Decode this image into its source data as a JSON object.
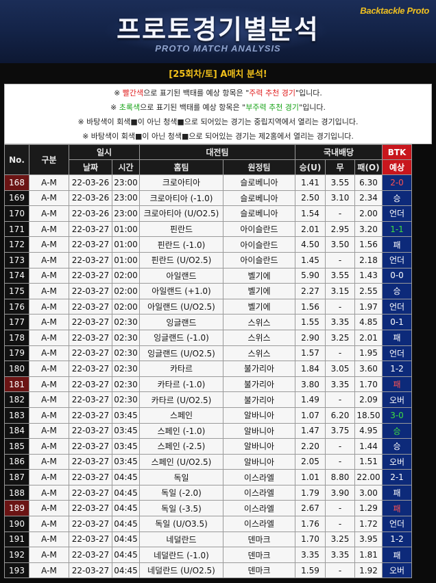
{
  "banner": {
    "title": "프로토경기별분석",
    "subtitle": "PROTO MATCH ANALYSIS",
    "brand": "Backtackle Proto"
  },
  "round_label": "[25회차/토] A매치 분석!",
  "notes": [
    {
      "pre": "※ ",
      "colored": "빨간색",
      "mid": "으로 표기된 백태를 예상 항목은 \"",
      "quote": "주력 추천 경기",
      "post": "\"입니다.",
      "color": "red"
    },
    {
      "pre": "※ ",
      "colored": "초록색",
      "mid": "으로 표기된 백태를 예상 항목은 \"",
      "quote": "부주력 추천 경기",
      "post": "\"입니다.",
      "color": "green"
    }
  ],
  "notes_plain": [
    "※ 바탕색이 회색■이 아닌 청색■으로 되어있는 경기는 중립지역에서 열리는 경기입니다.",
    "※ 바탕색이 회색■이 아닌 청색■으로 되어있는 경기는 제2홈에서 열리는 경기입니다."
  ],
  "header": {
    "no": "No.",
    "type": "구분",
    "datetime": "일시",
    "date": "날짜",
    "time": "시간",
    "match": "대전팀",
    "home": "홈팀",
    "away": "원정팀",
    "odds": "국내배당",
    "win": "승(U)",
    "draw": "무",
    "lose": "패(O)",
    "btk1": "BTK",
    "btk2": "예상"
  },
  "rows": [
    {
      "no": "168",
      "type": "A-M",
      "date": "22-03-26",
      "time": "23:00",
      "home": "크로아티아",
      "away": "슬로베니아",
      "w": "1.41",
      "d": "3.55",
      "l": "6.30",
      "pred": "2-0",
      "pc": "red"
    },
    {
      "no": "169",
      "type": "A-M",
      "date": "22-03-26",
      "time": "23:00",
      "home": "크로아티아 (-1.0)",
      "away": "슬로베니아",
      "w": "2.50",
      "d": "3.10",
      "l": "2.34",
      "pred": "승",
      "pc": ""
    },
    {
      "no": "170",
      "type": "A-M",
      "date": "22-03-26",
      "time": "23:00",
      "home": "크로아티아 (U/O2.5)",
      "away": "슬로베니아",
      "w": "1.54",
      "d": "-",
      "l": "2.00",
      "pred": "언더",
      "pc": ""
    },
    {
      "no": "171",
      "type": "A-M",
      "date": "22-03-27",
      "time": "01:00",
      "home": "핀란드",
      "away": "아이슬란드",
      "w": "2.01",
      "d": "2.95",
      "l": "3.20",
      "pred": "1-1",
      "pc": "green"
    },
    {
      "no": "172",
      "type": "A-M",
      "date": "22-03-27",
      "time": "01:00",
      "home": "핀란드 (-1.0)",
      "away": "아이슬란드",
      "w": "4.50",
      "d": "3.50",
      "l": "1.56",
      "pred": "패",
      "pc": ""
    },
    {
      "no": "173",
      "type": "A-M",
      "date": "22-03-27",
      "time": "01:00",
      "home": "핀란드 (U/O2.5)",
      "away": "아이슬란드",
      "w": "1.45",
      "d": "-",
      "l": "2.18",
      "pred": "언더",
      "pc": ""
    },
    {
      "no": "174",
      "type": "A-M",
      "date": "22-03-27",
      "time": "02:00",
      "home": "아일랜드",
      "away": "벨기에",
      "w": "5.90",
      "d": "3.55",
      "l": "1.43",
      "pred": "0-0",
      "pc": ""
    },
    {
      "no": "175",
      "type": "A-M",
      "date": "22-03-27",
      "time": "02:00",
      "home": "아일랜드 (+1.0)",
      "away": "벨기에",
      "w": "2.27",
      "d": "3.15",
      "l": "2.55",
      "pred": "승",
      "pc": ""
    },
    {
      "no": "176",
      "type": "A-M",
      "date": "22-03-27",
      "time": "02:00",
      "home": "아일랜드 (U/O2.5)",
      "away": "벨기에",
      "w": "1.56",
      "d": "-",
      "l": "1.97",
      "pred": "언더",
      "pc": ""
    },
    {
      "no": "177",
      "type": "A-M",
      "date": "22-03-27",
      "time": "02:30",
      "home": "잉글랜드",
      "away": "스위스",
      "w": "1.55",
      "d": "3.35",
      "l": "4.85",
      "pred": "0-1",
      "pc": ""
    },
    {
      "no": "178",
      "type": "A-M",
      "date": "22-03-27",
      "time": "02:30",
      "home": "잉글랜드 (-1.0)",
      "away": "스위스",
      "w": "2.90",
      "d": "3.25",
      "l": "2.01",
      "pred": "패",
      "pc": ""
    },
    {
      "no": "179",
      "type": "A-M",
      "date": "22-03-27",
      "time": "02:30",
      "home": "잉글랜드 (U/O2.5)",
      "away": "스위스",
      "w": "1.57",
      "d": "-",
      "l": "1.95",
      "pred": "언더",
      "pc": ""
    },
    {
      "no": "180",
      "type": "A-M",
      "date": "22-03-27",
      "time": "02:30",
      "home": "카타르",
      "away": "불가리아",
      "w": "1.84",
      "d": "3.05",
      "l": "3.60",
      "pred": "1-2",
      "pc": ""
    },
    {
      "no": "181",
      "type": "A-M",
      "date": "22-03-27",
      "time": "02:30",
      "home": "카타르 (-1.0)",
      "away": "불가리아",
      "w": "3.80",
      "d": "3.35",
      "l": "1.70",
      "pred": "패",
      "pc": "red"
    },
    {
      "no": "182",
      "type": "A-M",
      "date": "22-03-27",
      "time": "02:30",
      "home": "카타르 (U/O2.5)",
      "away": "불가리아",
      "w": "1.49",
      "d": "-",
      "l": "2.09",
      "pred": "오버",
      "pc": ""
    },
    {
      "no": "183",
      "type": "A-M",
      "date": "22-03-27",
      "time": "03:45",
      "home": "스페인",
      "away": "알바니아",
      "w": "1.07",
      "d": "6.20",
      "l": "18.50",
      "pred": "3-0",
      "pc": "green"
    },
    {
      "no": "184",
      "type": "A-M",
      "date": "22-03-27",
      "time": "03:45",
      "home": "스페인 (-1.0)",
      "away": "알바니아",
      "w": "1.47",
      "d": "3.75",
      "l": "4.95",
      "pred": "승",
      "pc": "green"
    },
    {
      "no": "185",
      "type": "A-M",
      "date": "22-03-27",
      "time": "03:45",
      "home": "스페인 (-2.5)",
      "away": "알바니아",
      "w": "2.20",
      "d": "-",
      "l": "1.44",
      "pred": "승",
      "pc": ""
    },
    {
      "no": "186",
      "type": "A-M",
      "date": "22-03-27",
      "time": "03:45",
      "home": "스페인 (U/O2.5)",
      "away": "알바니아",
      "w": "2.05",
      "d": "-",
      "l": "1.51",
      "pred": "오버",
      "pc": ""
    },
    {
      "no": "187",
      "type": "A-M",
      "date": "22-03-27",
      "time": "04:45",
      "home": "독일",
      "away": "이스라엘",
      "w": "1.01",
      "d": "8.80",
      "l": "22.00",
      "pred": "2-1",
      "pc": ""
    },
    {
      "no": "188",
      "type": "A-M",
      "date": "22-03-27",
      "time": "04:45",
      "home": "독일 (-2.0)",
      "away": "이스라엘",
      "w": "1.79",
      "d": "3.90",
      "l": "3.00",
      "pred": "패",
      "pc": ""
    },
    {
      "no": "189",
      "type": "A-M",
      "date": "22-03-27",
      "time": "04:45",
      "home": "독일 (-3.5)",
      "away": "이스라엘",
      "w": "2.67",
      "d": "-",
      "l": "1.29",
      "pred": "패",
      "pc": "red"
    },
    {
      "no": "190",
      "type": "A-M",
      "date": "22-03-27",
      "time": "04:45",
      "home": "독일 (U/O3.5)",
      "away": "이스라엘",
      "w": "1.76",
      "d": "-",
      "l": "1.72",
      "pred": "언더",
      "pc": ""
    },
    {
      "no": "191",
      "type": "A-M",
      "date": "22-03-27",
      "time": "04:45",
      "home": "네덜란드",
      "away": "덴마크",
      "w": "1.70",
      "d": "3.25",
      "l": "3.95",
      "pred": "1-2",
      "pc": ""
    },
    {
      "no": "192",
      "type": "A-M",
      "date": "22-03-27",
      "time": "04:45",
      "home": "네덜란드 (-1.0)",
      "away": "덴마크",
      "w": "3.35",
      "d": "3.35",
      "l": "1.81",
      "pred": "패",
      "pc": ""
    },
    {
      "no": "193",
      "type": "A-M",
      "date": "22-03-27",
      "time": "04:45",
      "home": "네덜란드 (U/O2.5)",
      "away": "덴마크",
      "w": "1.59",
      "d": "-",
      "l": "1.92",
      "pred": "오버",
      "pc": ""
    }
  ],
  "colors": {
    "accent_red": "#e02020",
    "accent_green": "#17a317",
    "btk_header": "#c8161d",
    "result_bg": "#0d2a7a",
    "round_gold": "#f3c21b"
  }
}
